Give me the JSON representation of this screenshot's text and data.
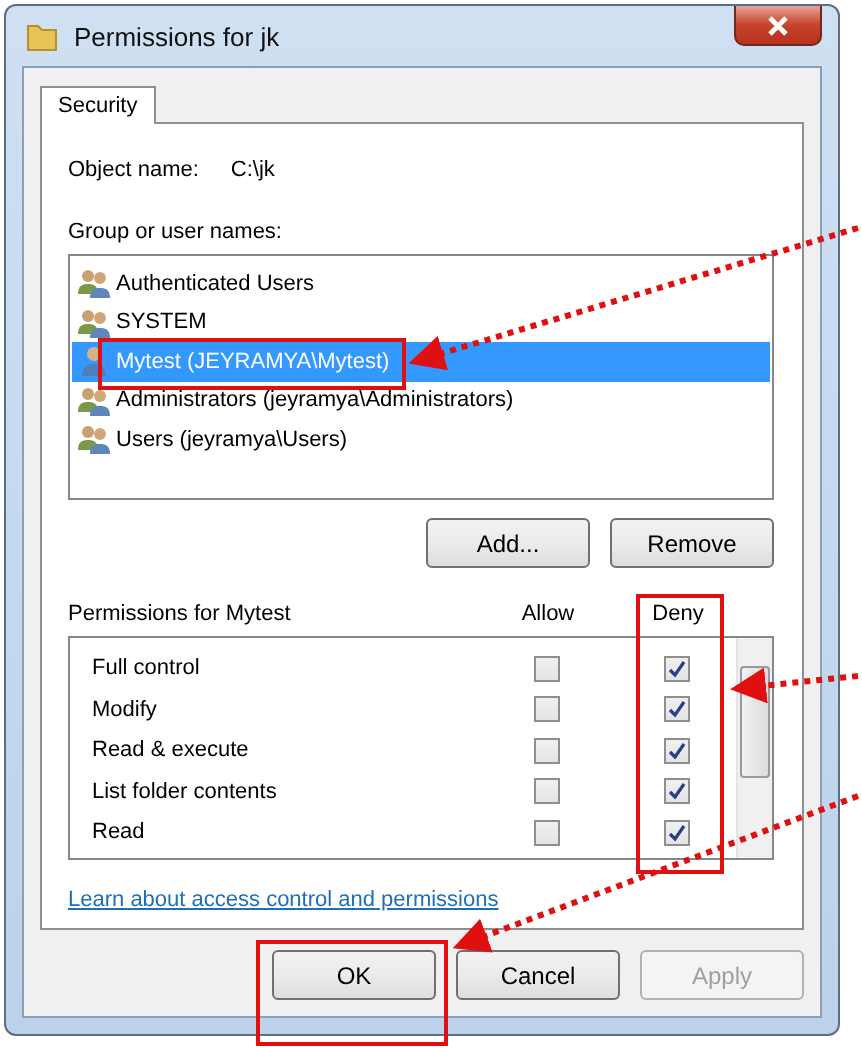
{
  "window": {
    "title": "Permissions for jk"
  },
  "tabs": [
    {
      "label": "Security",
      "selected": true
    }
  ],
  "object": {
    "label": "Object name:",
    "value": "C:\\jk"
  },
  "group_label": "Group or user names:",
  "users": [
    {
      "name": "Authenticated Users",
      "kind": "group",
      "selected": false
    },
    {
      "name": "SYSTEM",
      "kind": "group",
      "selected": false
    },
    {
      "name": "Mytest (JEYRAMYA\\Mytest)",
      "kind": "user",
      "selected": true
    },
    {
      "name": "Administrators (jeyramya\\Administrators)",
      "kind": "group",
      "selected": false
    },
    {
      "name": "Users (jeyramya\\Users)",
      "kind": "group",
      "selected": false
    }
  ],
  "user_buttons": [
    "Add...",
    "Remove"
  ],
  "permissions": {
    "title": "Permissions for Mytest",
    "columns": [
      "Allow",
      "Deny"
    ],
    "rows": [
      {
        "name": "Full control",
        "allow": false,
        "deny": true
      },
      {
        "name": "Modify",
        "allow": false,
        "deny": true
      },
      {
        "name": "Read & execute",
        "allow": false,
        "deny": true
      },
      {
        "name": "List folder contents",
        "allow": false,
        "deny": true
      },
      {
        "name": "Read",
        "allow": false,
        "deny": true
      }
    ]
  },
  "link": "Learn about access control and permissions",
  "buttons": [
    {
      "label": "OK",
      "disabled": false
    },
    {
      "label": "Cancel",
      "disabled": false
    },
    {
      "label": "Apply",
      "disabled": true
    }
  ]
}
